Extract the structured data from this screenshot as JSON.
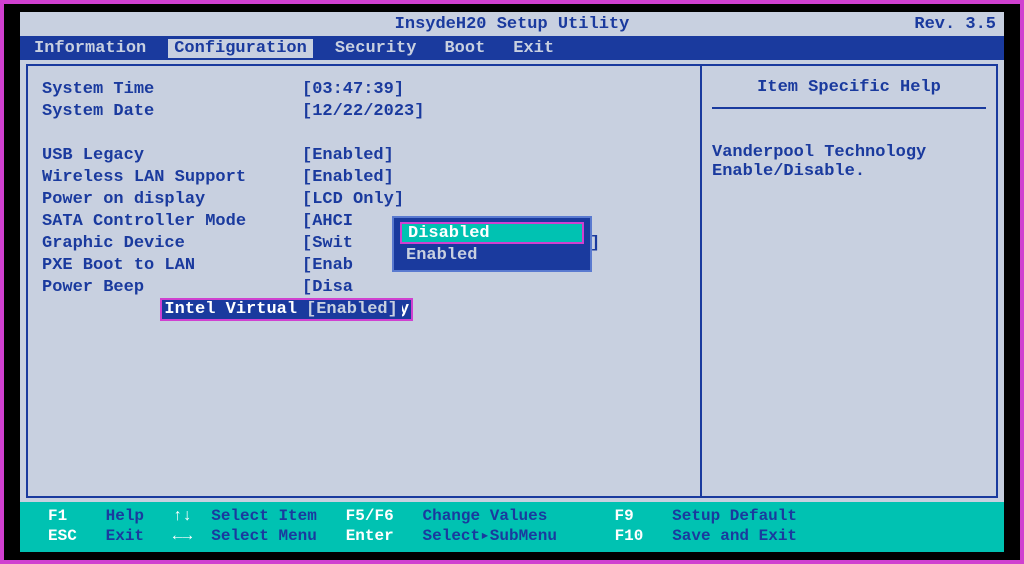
{
  "title": "InsydeH20 Setup Utility",
  "rev": "Rev. 3.5",
  "menu": {
    "items": [
      "Information",
      "Configuration",
      "Security",
      "Boot",
      "Exit"
    ],
    "active": 1
  },
  "settings": {
    "items": [
      {
        "label": "System Time",
        "value": "[03:47:39]"
      },
      {
        "label": "System Date",
        "value": "[12/22/2023]"
      }
    ],
    "items2": [
      {
        "label": "USB Legacy",
        "value": "[Enabled]"
      },
      {
        "label": "Wireless LAN Support",
        "value": "[Enabled]"
      },
      {
        "label": "Power on display",
        "value": "[LCD Only]"
      },
      {
        "label": "SATA Controller Mode",
        "value": "[AHCI"
      },
      {
        "label": "Graphic Device",
        "value": "[Swit"
      },
      {
        "label": "PXE Boot to LAN",
        "value": "[Enab"
      },
      {
        "label": "Power Beep",
        "value": "[Disa"
      }
    ],
    "selected": {
      "label": "Intel Virtual Technology",
      "value": "[Enabled]"
    },
    "graphic_right_bracket": "]"
  },
  "popup": {
    "options": [
      "Disabled",
      "Enabled"
    ],
    "selected": 0
  },
  "help": {
    "title": "Item Specific Help",
    "body1": "Vanderpool Technology",
    "body2": "Enable/Disable."
  },
  "footer": {
    "f1": "F1",
    "help": "Help",
    "arrows_ud": "↑↓",
    "select_item": "Select Item",
    "f5f6": "F5/F6",
    "change_values": "Change Values",
    "f9": "F9",
    "setup_default": "Setup Default",
    "esc": "ESC",
    "exit": "Exit",
    "arrows_lr": "←→",
    "select_menu": "Select Menu",
    "enter": "Enter",
    "select_submenu": "Select▸SubMenu",
    "f10": "F10",
    "save_exit": "Save and Exit"
  }
}
